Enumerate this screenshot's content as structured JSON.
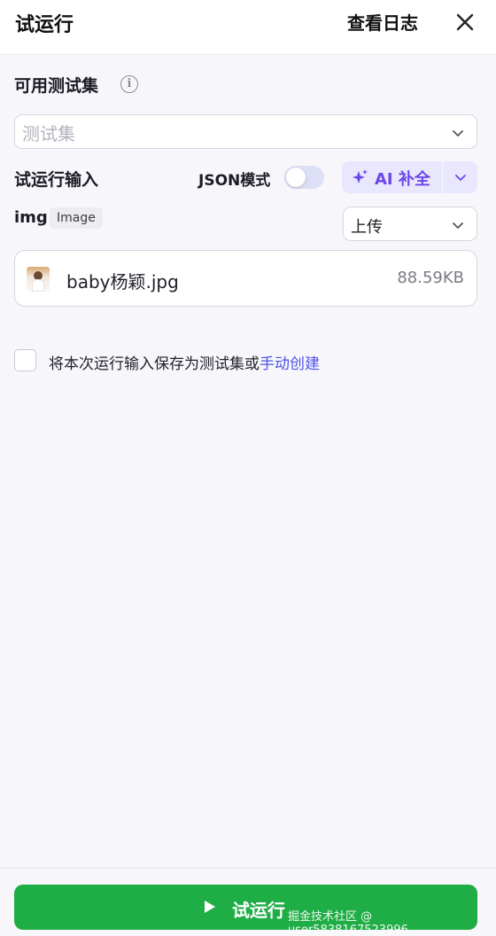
{
  "header": {
    "title": "试运行",
    "log_label": "查看日志"
  },
  "test_set": {
    "label": "可用测试集",
    "placeholder": "测试集"
  },
  "run_input": {
    "label": "试运行输入",
    "json_mode_label": "JSON模式",
    "json_mode_on": false,
    "ai_fill_label": "AI 补全"
  },
  "param": {
    "name": "img",
    "type_badge": "Image",
    "source_value": "上传"
  },
  "file": {
    "name": "baby杨颖.jpg",
    "size": "88.59KB"
  },
  "save": {
    "text": "将本次运行输入保存为测试集或",
    "link": "手动创建",
    "checked": false
  },
  "run_button": {
    "label": "试运行"
  },
  "watermark": "掘金技术社区 @ user5838167523996",
  "colors": {
    "primary_green": "#1fad45",
    "ai_purple": "#6b46e8",
    "link_blue": "#4d53e8"
  }
}
